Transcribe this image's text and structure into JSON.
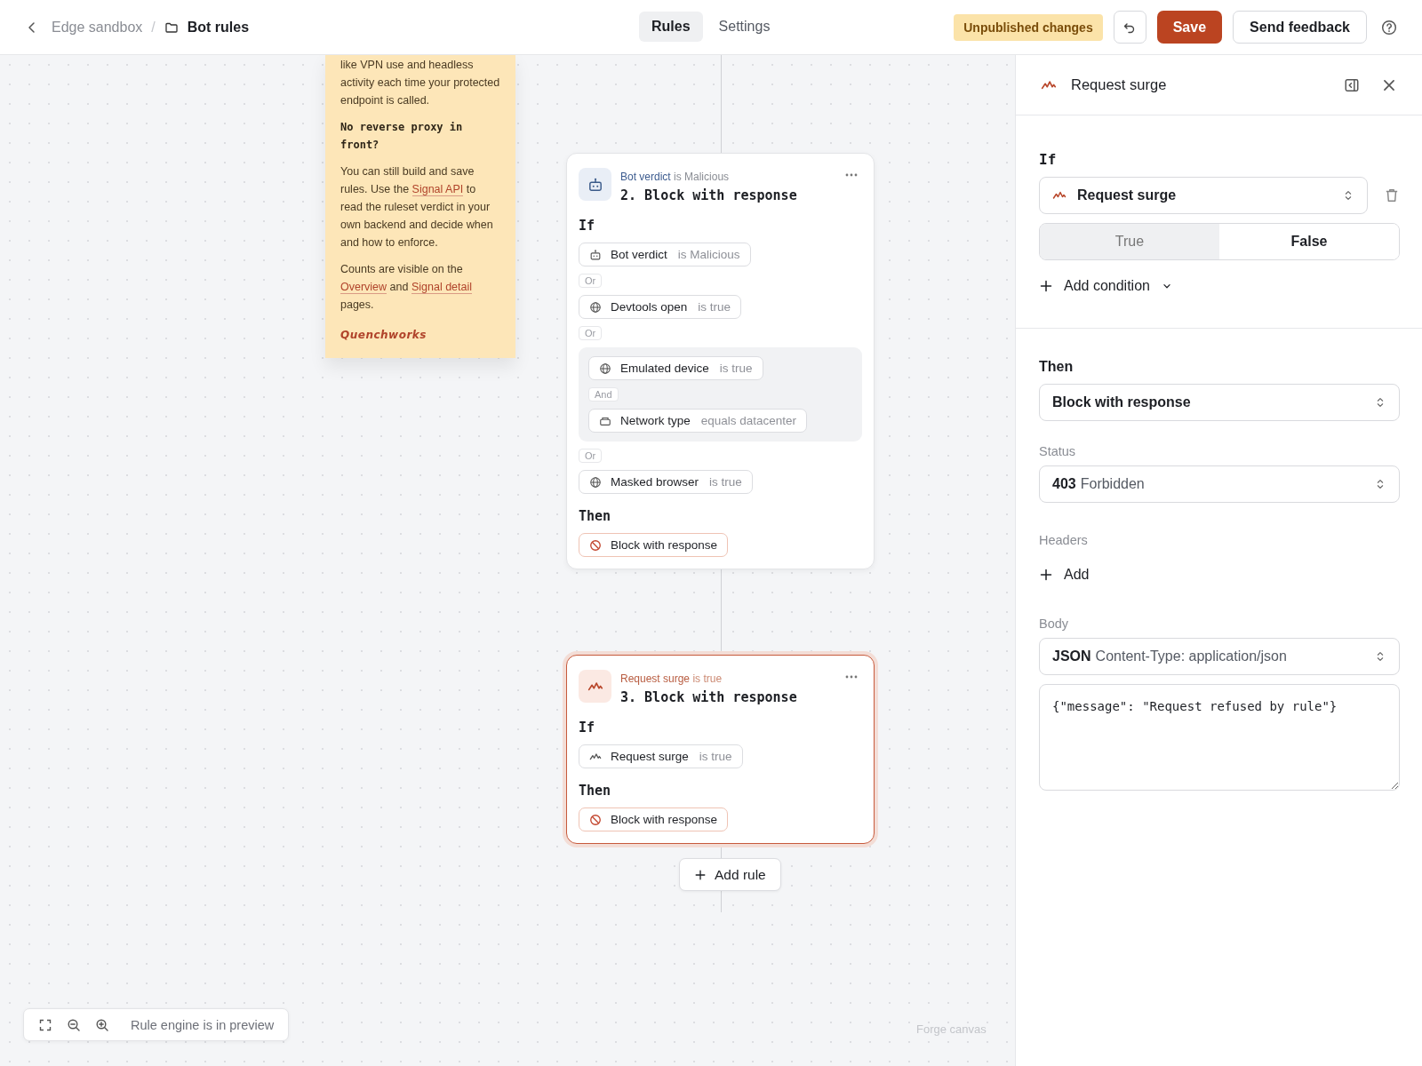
{
  "breadcrumb": {
    "parent": "Edge sandbox",
    "separator": "/",
    "current": "Bot rules"
  },
  "tabs": [
    {
      "label": "Rules",
      "selected": true
    },
    {
      "label": "Settings",
      "selected": false
    }
  ],
  "status_badge": "Unpublished changes",
  "save_button": "Save",
  "feedback_button": "Send feedback",
  "note": {
    "paragraphs": [
      {
        "kind": "text",
        "parts": [
          {
            "kind": "text",
            "text": "like VPN use and headless activity each time your protected endpoint is called."
          }
        ]
      },
      {
        "kind": "heading",
        "parts": [
          {
            "kind": "text",
            "text": "No reverse proxy in front?"
          }
        ]
      },
      {
        "kind": "text",
        "parts": [
          {
            "kind": "text",
            "text": "You can still build and save rules. Use the "
          },
          {
            "kind": "link",
            "text": "Signal API"
          },
          {
            "kind": "text",
            "text": " to read the ruleset verdict in your own backend and decide when and how to enforce."
          }
        ]
      },
      {
        "kind": "text",
        "parts": [
          {
            "kind": "text",
            "text": "Counts are visible on the "
          },
          {
            "kind": "link",
            "text": "Overview"
          },
          {
            "kind": "text",
            "text": " and "
          },
          {
            "kind": "link",
            "text": "Signal detail"
          },
          {
            "kind": "text",
            "text": " pages."
          }
        ]
      },
      {
        "kind": "signature",
        "parts": [
          {
            "kind": "text",
            "text": "Quenchworks"
          }
        ]
      }
    ]
  },
  "rules": [
    {
      "selected": false,
      "trigger_signal": "Bot verdict",
      "trigger_op": "is Malicious",
      "title": "2. Block with response",
      "if_label": "If",
      "then_label": "Then",
      "conditions": [
        {
          "kind": "condition",
          "name": "Bot verdict",
          "op": "is Malicious"
        },
        {
          "kind": "joiner",
          "label": "Or"
        },
        {
          "kind": "condition",
          "name": "Devtools open",
          "op": "is true"
        },
        {
          "kind": "joiner",
          "label": "Or"
        },
        {
          "kind": "group",
          "children": [
            {
              "kind": "condition",
              "name": "Emulated device",
              "op": "is true"
            },
            {
              "kind": "joiner",
              "label": "And"
            },
            {
              "kind": "condition",
              "name": "Network type",
              "op": "equals datacenter"
            }
          ]
        },
        {
          "kind": "joiner",
          "label": "Or"
        },
        {
          "kind": "condition",
          "name": "Masked browser",
          "op": "is true"
        }
      ],
      "action": "Block with response"
    },
    {
      "selected": true,
      "trigger_signal": "Request surge",
      "trigger_op": "is true",
      "title": "3. Block with response",
      "if_label": "If",
      "then_label": "Then",
      "conditions": [
        {
          "kind": "condition",
          "name": "Request surge",
          "op": "is true"
        }
      ],
      "action": "Block with response"
    }
  ],
  "add_rule_button": "Add rule",
  "canvas_toolbar": {
    "text": "Rule engine is in preview"
  },
  "canvas_label": "Forge canvas",
  "panel": {
    "title": "Request surge",
    "if_label": "If",
    "condition_select": "Request surge",
    "toggle": [
      {
        "label": "True",
        "selected": false
      },
      {
        "label": "False",
        "selected": true
      }
    ],
    "add_condition": "Add condition",
    "then_label": "Then",
    "action_select": "Block with response",
    "status_label": "Status",
    "status_code": "403",
    "status_text": "Forbidden",
    "headers_label": "Headers",
    "headers_add": "Add",
    "body_label": "Body",
    "body_type": "JSON",
    "body_content_type": "Content-Type: application/json",
    "body_value": "{\"message\": \"Request refused by rule\"}"
  }
}
